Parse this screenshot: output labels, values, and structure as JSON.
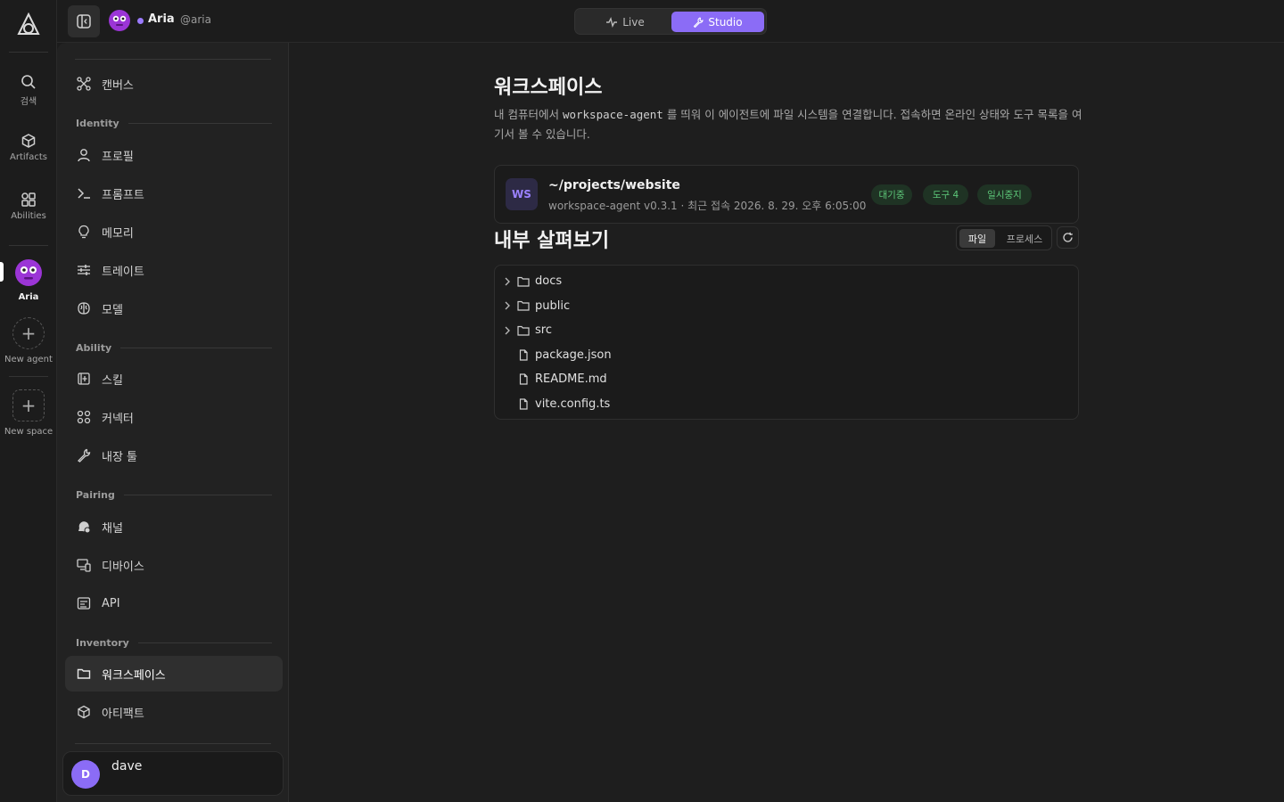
{
  "rail": {
    "search_label": "검색",
    "artifacts_label": "Artifacts",
    "abilities_label": "Abilities",
    "agent_label": "Aria",
    "new_agent_label": "New agent",
    "new_space_label": "New space"
  },
  "topbar": {
    "agent_name": "Aria",
    "agent_handle": "@aria",
    "mode_live": "Live",
    "mode_studio": "Studio"
  },
  "sidebar": {
    "canvas": "캔버스",
    "identity_heading": "Identity",
    "identity_items": [
      "프로필",
      "프롬프트",
      "메모리",
      "트레이트",
      "모델"
    ],
    "ability_heading": "Ability",
    "ability_items": [
      "스킬",
      "커넥터",
      "내장 툴"
    ],
    "pairing_heading": "Pairing",
    "pairing_items": [
      "채널",
      "디바이스",
      "API"
    ],
    "inventory_heading": "Inventory",
    "inventory_items": [
      "워크스페이스",
      "아티팩트"
    ],
    "user_initial": "D",
    "user_name": "dave"
  },
  "main": {
    "title": "워크스페이스",
    "desc_before": "내 컴퓨터에서 ",
    "desc_code": "workspace-agent",
    "desc_after": " 를 띄워 이 에이전트에 파일 시스템을 연결합니다. 접속하면 온라인 상태와 도구 목록을 여기서 볼 수 있습니다.",
    "workspace": {
      "badge": "WS",
      "path": "~/projects/website",
      "meta": "workspace-agent v0.3.1 · 최근 접속 2026. 8. 29. 오후 6:05:00",
      "chips": [
        "대기중",
        "도구 4",
        "일시중지"
      ]
    },
    "inspect_title": "내부 살펴보기",
    "tab_files": "파일",
    "tab_processes": "프로세스",
    "tree": [
      {
        "name": "docs",
        "type": "folder"
      },
      {
        "name": "public",
        "type": "folder"
      },
      {
        "name": "src",
        "type": "folder"
      },
      {
        "name": "package.json",
        "type": "file"
      },
      {
        "name": "README.md",
        "type": "file"
      },
      {
        "name": "vite.config.ts",
        "type": "file"
      }
    ]
  },
  "colors": {
    "accent": "#8b6cf6",
    "chip_green": "#5ec97a"
  }
}
